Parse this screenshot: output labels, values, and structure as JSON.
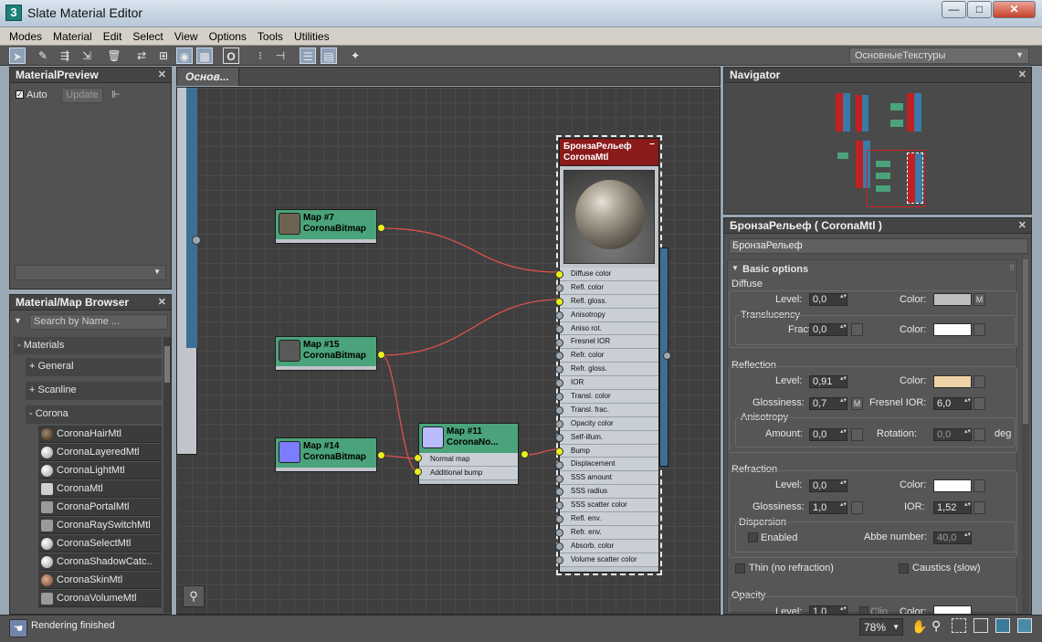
{
  "window": {
    "title": "Slate Material Editor",
    "app_icon": "3",
    "min": "—",
    "max": "□",
    "close": "✕"
  },
  "menu": [
    "Modes",
    "Material",
    "Edit",
    "Select",
    "View",
    "Options",
    "Tools",
    "Utilities"
  ],
  "toolbar": {
    "texture_set": "ОсновныеТекстуры"
  },
  "material_preview": {
    "title": "MaterialPreview",
    "auto_label": "Auto",
    "update_label": "Update"
  },
  "browser": {
    "title": "Material/Map Browser",
    "search_placeholder": "Search by Name ...",
    "groups": {
      "materials": "- Materials",
      "general": "+ General",
      "scanline": "+ Scanline",
      "corona": "- Corona"
    },
    "items": [
      "CoronaHairMtl",
      "CoronaLayeredMtl",
      "CoronaLightMtl",
      "CoronaMtl",
      "CoronaPortalMtl",
      "CoronaRaySwitchMtl",
      "CoronaSelectMtl",
      "CoronaShadowCatc..",
      "CoronaSkinMtl",
      "CoronaVolumeMtl"
    ]
  },
  "view_tab": "Основ...",
  "nodes": {
    "map7": {
      "title": "Map #7",
      "type": "CoronaBitmap",
      "thumb_color": "#6e6254"
    },
    "map15": {
      "title": "Map #15",
      "type": "CoronaBitmap",
      "thumb_color": "#595959"
    },
    "map14": {
      "title": "Map #14",
      "type": "CoronaBitmap",
      "thumb_color": "#7c7cff"
    },
    "map11": {
      "title": "Map #11",
      "type": "CoronaNo...",
      "thumb_color": "#b8bcff",
      "slots": [
        "Normal map",
        "Additional bump"
      ]
    },
    "material": {
      "title": "БронзаРельеф",
      "type": "CoronaMtl",
      "slots": [
        "Diffuse color",
        "Refl. color",
        "Refl. gloss.",
        "Anisotropy",
        "Aniso rot.",
        "Fresnel IOR",
        "Refr. color",
        "Refr. gloss.",
        "IOR",
        "Transl. color",
        "Transl. frac.",
        "Opacity color",
        "Self-illum.",
        "Bump",
        "Displacement",
        "SSS amount",
        "SSS radius",
        "SSS scatter color",
        "Refl. env.",
        "Refr. env.",
        "Absorb. color",
        "Volume scatter color"
      ]
    }
  },
  "navigator": {
    "title": "Navigator"
  },
  "params": {
    "title": "БронзаРельеф  ( CoronaMtl )",
    "name_field": "БронзаРельеф",
    "rollout": "Basic options",
    "diffuse": {
      "section": "Diffuse",
      "level_label": "Level:",
      "level": "0,0",
      "color_label": "Color:",
      "color": "#bdbdbd",
      "map_btn": "M"
    },
    "translucency": {
      "section": "Translucency",
      "fraction_label": "Fraction:",
      "fraction": "0,0",
      "color_label": "Color:",
      "color": "#ffffff"
    },
    "reflection": {
      "section": "Reflection",
      "level_label": "Level:",
      "level": "0,91",
      "color_label": "Color:",
      "color": "#efd2a6",
      "gloss_label": "Glossiness:",
      "gloss": "0,7",
      "map_btn": "M",
      "fresnel_label": "Fresnel IOR:",
      "fresnel": "6,0"
    },
    "anisotropy": {
      "section": "Anisotropy",
      "amount_label": "Amount:",
      "amount": "0,0",
      "rotation_label": "Rotation:",
      "rotation": "0,0",
      "unit": "deg"
    },
    "refraction": {
      "section": "Refraction",
      "level_label": "Level:",
      "level": "0,0",
      "color_label": "Color:",
      "color": "#ffffff",
      "gloss_label": "Glossiness:",
      "gloss": "1,0",
      "ior_label": "IOR:",
      "ior": "1,52"
    },
    "dispersion": {
      "section": "Dispersion",
      "enabled_label": "Enabled",
      "abbe_label": "Abbe number:",
      "abbe": "40,0"
    },
    "thin_label": "Thin (no refraction)",
    "caustics_label": "Caustics (slow)",
    "opacity": {
      "section": "Opacity",
      "level_label": "Level:",
      "level": "1,0",
      "clip_label": "Clip",
      "color_label": "Color:"
    }
  },
  "status": {
    "text": "Rendering finished",
    "zoom": "78%"
  }
}
